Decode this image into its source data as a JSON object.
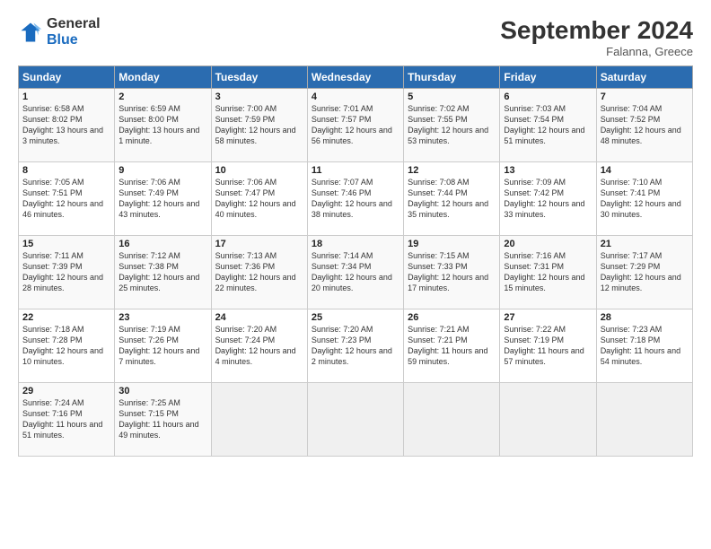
{
  "header": {
    "logo_line1": "General",
    "logo_line2": "Blue",
    "month": "September 2024",
    "location": "Falanna, Greece"
  },
  "weekdays": [
    "Sunday",
    "Monday",
    "Tuesday",
    "Wednesday",
    "Thursday",
    "Friday",
    "Saturday"
  ],
  "weeks": [
    [
      {
        "day": "1",
        "sunrise": "6:58 AM",
        "sunset": "8:02 PM",
        "daylight": "13 hours and 3 minutes."
      },
      {
        "day": "2",
        "sunrise": "6:59 AM",
        "sunset": "8:00 PM",
        "daylight": "13 hours and 1 minute."
      },
      {
        "day": "3",
        "sunrise": "7:00 AM",
        "sunset": "7:59 PM",
        "daylight": "12 hours and 58 minutes."
      },
      {
        "day": "4",
        "sunrise": "7:01 AM",
        "sunset": "7:57 PM",
        "daylight": "12 hours and 56 minutes."
      },
      {
        "day": "5",
        "sunrise": "7:02 AM",
        "sunset": "7:55 PM",
        "daylight": "12 hours and 53 minutes."
      },
      {
        "day": "6",
        "sunrise": "7:03 AM",
        "sunset": "7:54 PM",
        "daylight": "12 hours and 51 minutes."
      },
      {
        "day": "7",
        "sunrise": "7:04 AM",
        "sunset": "7:52 PM",
        "daylight": "12 hours and 48 minutes."
      }
    ],
    [
      {
        "day": "8",
        "sunrise": "7:05 AM",
        "sunset": "7:51 PM",
        "daylight": "12 hours and 46 minutes."
      },
      {
        "day": "9",
        "sunrise": "7:06 AM",
        "sunset": "7:49 PM",
        "daylight": "12 hours and 43 minutes."
      },
      {
        "day": "10",
        "sunrise": "7:06 AM",
        "sunset": "7:47 PM",
        "daylight": "12 hours and 40 minutes."
      },
      {
        "day": "11",
        "sunrise": "7:07 AM",
        "sunset": "7:46 PM",
        "daylight": "12 hours and 38 minutes."
      },
      {
        "day": "12",
        "sunrise": "7:08 AM",
        "sunset": "7:44 PM",
        "daylight": "12 hours and 35 minutes."
      },
      {
        "day": "13",
        "sunrise": "7:09 AM",
        "sunset": "7:42 PM",
        "daylight": "12 hours and 33 minutes."
      },
      {
        "day": "14",
        "sunrise": "7:10 AM",
        "sunset": "7:41 PM",
        "daylight": "12 hours and 30 minutes."
      }
    ],
    [
      {
        "day": "15",
        "sunrise": "7:11 AM",
        "sunset": "7:39 PM",
        "daylight": "12 hours and 28 minutes."
      },
      {
        "day": "16",
        "sunrise": "7:12 AM",
        "sunset": "7:38 PM",
        "daylight": "12 hours and 25 minutes."
      },
      {
        "day": "17",
        "sunrise": "7:13 AM",
        "sunset": "7:36 PM",
        "daylight": "12 hours and 22 minutes."
      },
      {
        "day": "18",
        "sunrise": "7:14 AM",
        "sunset": "7:34 PM",
        "daylight": "12 hours and 20 minutes."
      },
      {
        "day": "19",
        "sunrise": "7:15 AM",
        "sunset": "7:33 PM",
        "daylight": "12 hours and 17 minutes."
      },
      {
        "day": "20",
        "sunrise": "7:16 AM",
        "sunset": "7:31 PM",
        "daylight": "12 hours and 15 minutes."
      },
      {
        "day": "21",
        "sunrise": "7:17 AM",
        "sunset": "7:29 PM",
        "daylight": "12 hours and 12 minutes."
      }
    ],
    [
      {
        "day": "22",
        "sunrise": "7:18 AM",
        "sunset": "7:28 PM",
        "daylight": "12 hours and 10 minutes."
      },
      {
        "day": "23",
        "sunrise": "7:19 AM",
        "sunset": "7:26 PM",
        "daylight": "12 hours and 7 minutes."
      },
      {
        "day": "24",
        "sunrise": "7:20 AM",
        "sunset": "7:24 PM",
        "daylight": "12 hours and 4 minutes."
      },
      {
        "day": "25",
        "sunrise": "7:20 AM",
        "sunset": "7:23 PM",
        "daylight": "12 hours and 2 minutes."
      },
      {
        "day": "26",
        "sunrise": "7:21 AM",
        "sunset": "7:21 PM",
        "daylight": "11 hours and 59 minutes."
      },
      {
        "day": "27",
        "sunrise": "7:22 AM",
        "sunset": "7:19 PM",
        "daylight": "11 hours and 57 minutes."
      },
      {
        "day": "28",
        "sunrise": "7:23 AM",
        "sunset": "7:18 PM",
        "daylight": "11 hours and 54 minutes."
      }
    ],
    [
      {
        "day": "29",
        "sunrise": "7:24 AM",
        "sunset": "7:16 PM",
        "daylight": "11 hours and 51 minutes."
      },
      {
        "day": "30",
        "sunrise": "7:25 AM",
        "sunset": "7:15 PM",
        "daylight": "11 hours and 49 minutes."
      },
      null,
      null,
      null,
      null,
      null
    ]
  ]
}
